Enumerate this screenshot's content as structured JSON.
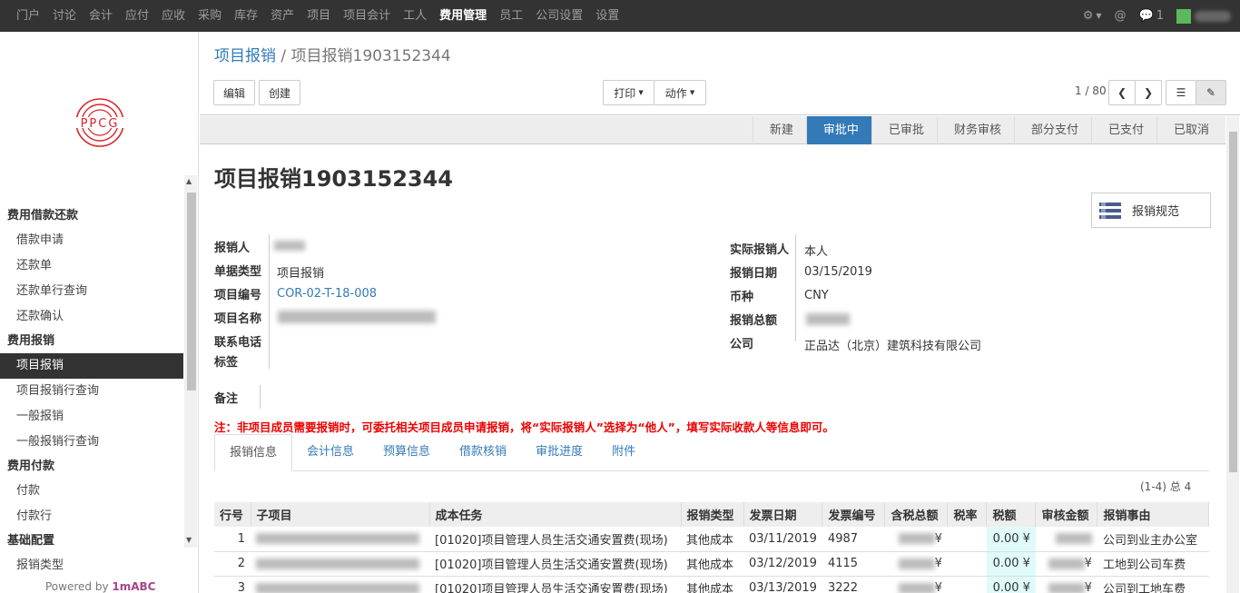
{
  "topnav": {
    "items": [
      "门户",
      "讨论",
      "会计",
      "应付",
      "应收",
      "采购",
      "库存",
      "资产",
      "项目",
      "项目会计",
      "工人",
      "费用管理",
      "员工",
      "公司设置",
      "设置"
    ],
    "active_index": 11,
    "message_count": "1"
  },
  "sidebar": {
    "logo_text": "PPCG",
    "sections": [
      {
        "heading": "费用借款还款",
        "items": [
          "借款申请",
          "还款单",
          "还款单行查询",
          "还款确认"
        ]
      },
      {
        "heading": "费用报销",
        "items": [
          "项目报销",
          "项目报销行查询",
          "一般报销",
          "一般报销行查询"
        ]
      },
      {
        "heading": "费用付款",
        "items": [
          "付款",
          "付款行"
        ]
      },
      {
        "heading": "基础配置",
        "items": [
          "报销类型"
        ]
      }
    ],
    "active_item": "项目报销",
    "powered_prefix": "Powered by ",
    "powered_brand": "1mABC"
  },
  "control_panel": {
    "breadcrumb_parent": "项目报销",
    "breadcrumb_sep": "/",
    "breadcrumb_current": "项目报销1903152344",
    "edit_label": "编辑",
    "create_label": "创建",
    "print_label": "打印",
    "action_label": "动作",
    "pager": "1 / 80"
  },
  "status": {
    "stages": [
      "新建",
      "审批中",
      "已审批",
      "财务审核",
      "部分支付",
      "已支付",
      "已取消"
    ],
    "current": "审批中"
  },
  "form": {
    "title": "项目报销1903152344",
    "rule_button": "报销规范",
    "labels": {
      "applicant": "报销人",
      "doc_type": "单据类型",
      "project_code": "项目编号",
      "project_name": "项目名称",
      "phone": "联系电话",
      "tags": "标签",
      "actual_applicant": "实际报销人",
      "date": "报销日期",
      "currency": "币种",
      "total": "报销总额",
      "company": "公司",
      "remark": "备注"
    },
    "values": {
      "doc_type": "项目报销",
      "project_code": "COR-02-T-18-008",
      "actual_applicant": "本人",
      "date": "03/15/2019",
      "currency": "CNY",
      "company": "正品达（北京）建筑科技有限公司"
    },
    "note": "注：非项目成员需要报销时，可委托相关项目成员申请报销，将“实际报销人”选择为“他人”，填写实际收款人等信息即可。"
  },
  "tabs": [
    "报销信息",
    "会计信息",
    "预算信息",
    "借款核销",
    "审批进度",
    "附件"
  ],
  "active_tab": "报销信息",
  "record_count": "(1-4) 总 4",
  "table": {
    "headers": [
      "行号",
      "子项目",
      "成本任务",
      "报销类型",
      "发票日期",
      "发票编号",
      "含税总额",
      "税率",
      "税额",
      "审核金额",
      "报销事由"
    ],
    "rows": [
      {
        "no": "1",
        "task": "[01020]项目管理人员生活交通安置费(现场)",
        "type": "其他成本",
        "date": "03/11/2019",
        "invoice": "4987",
        "total_suffix": "¥",
        "tax": "0.00 ¥",
        "audit_suffix": "",
        "reason": "公司到业主办公室"
      },
      {
        "no": "2",
        "task": "[01020]项目管理人员生活交通安置费(现场)",
        "type": "其他成本",
        "date": "03/12/2019",
        "invoice": "4115",
        "total_suffix": "¥",
        "tax": "0.00 ¥",
        "audit_suffix": "¥",
        "reason": "工地到公司车费"
      },
      {
        "no": "3",
        "task": "[01020]项目管理人员生活交通安置费(现场)",
        "type": "其他成本",
        "date": "03/13/2019",
        "invoice": "3222",
        "total_suffix": "¥",
        "tax": "0.00 ¥",
        "audit_suffix": "¥",
        "reason": "公司到工地车费"
      }
    ]
  }
}
